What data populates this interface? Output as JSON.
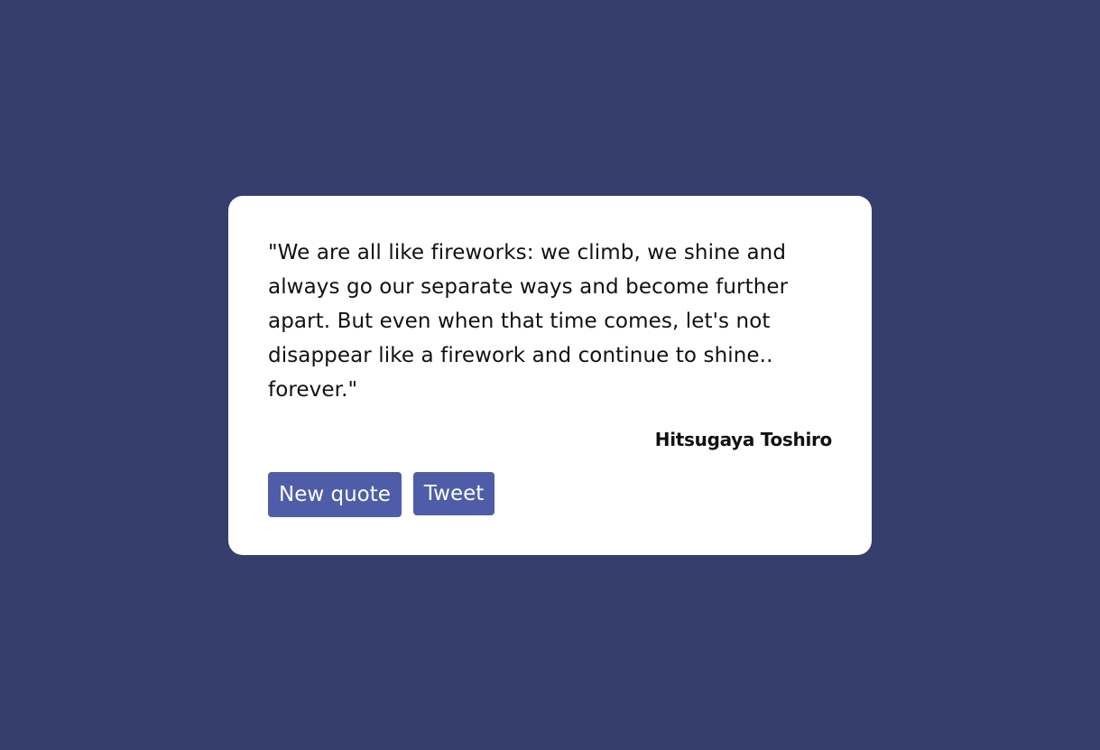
{
  "quote": {
    "text": "\"We are all like fireworks: we climb, we shine and always go our separate ways and become further apart. But even when that time comes, let's not disappear like a firework and continue to shine.. forever.\"",
    "author": "Hitsugaya Toshiro"
  },
  "actions": {
    "new_quote_label": "New quote",
    "tweet_label": "Tweet"
  },
  "colors": {
    "background": "#363e6e",
    "card": "#ffffff",
    "button": "#4f5da9",
    "text": "#111111"
  }
}
